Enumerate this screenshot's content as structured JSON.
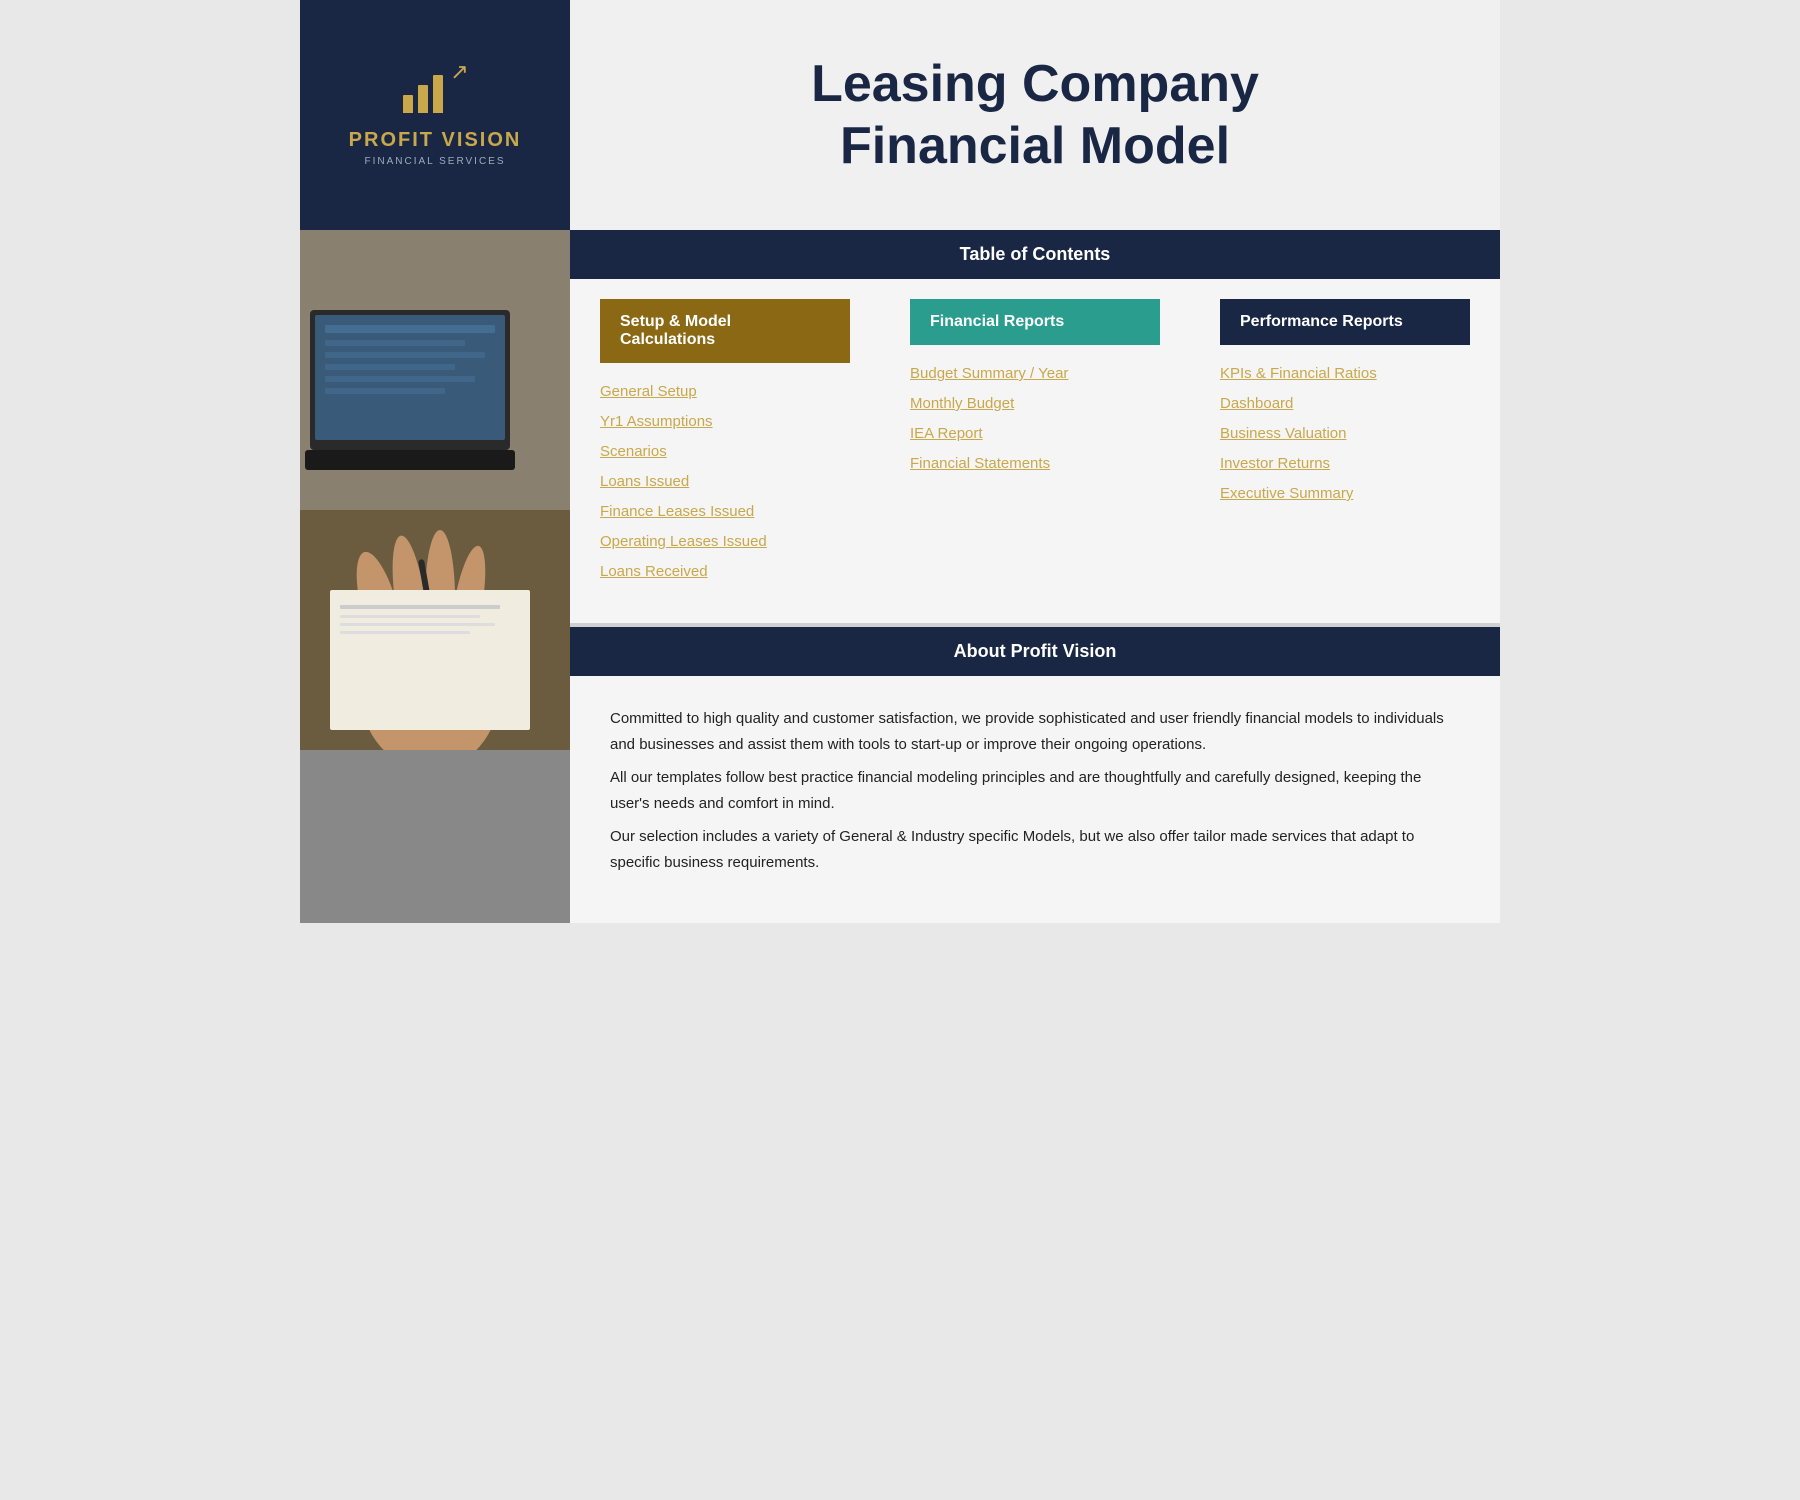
{
  "header": {
    "logo": {
      "company_name": "PROFIT VISION",
      "sub": "FINANCIAL SERVICES"
    },
    "title_line1": "Leasing Company",
    "title_line2": "Financial Model"
  },
  "toc": {
    "heading": "Table of Contents",
    "columns": [
      {
        "id": "setup",
        "header": "Setup & Model Calculations",
        "style": "gold",
        "links": [
          "General Setup",
          "Yr1 Assumptions",
          "Scenarios",
          "Loans Issued",
          "Finance Leases Issued",
          "Operating Leases Issued",
          "Loans Received"
        ]
      },
      {
        "id": "financial",
        "header": "Financial Reports",
        "style": "teal",
        "links": [
          "Budget Summary / Year",
          "Monthly Budget",
          "IEA Report",
          "Financial Statements"
        ]
      },
      {
        "id": "performance",
        "header": "Performance Reports",
        "style": "dark",
        "links": [
          "KPIs & Financial Ratios",
          "Dashboard",
          "Business Valuation",
          "Investor Returns",
          "Executive Summary"
        ]
      }
    ]
  },
  "about": {
    "heading": "About Profit Vision",
    "paragraph1": "Committed to high quality and customer satisfaction, we provide sophisticated and user friendly financial models to individuals and businesses and assist them  with tools to start-up or improve their ongoing operations.",
    "paragraph2": "All our templates follow best practice financial modeling principles and are thoughtfully and carefully designed, keeping the user's needs and comfort in mind.",
    "paragraph3": "Our selection includes a variety of General & Industry specific Models, but we also offer tailor made services that adapt to specific business requirements."
  }
}
